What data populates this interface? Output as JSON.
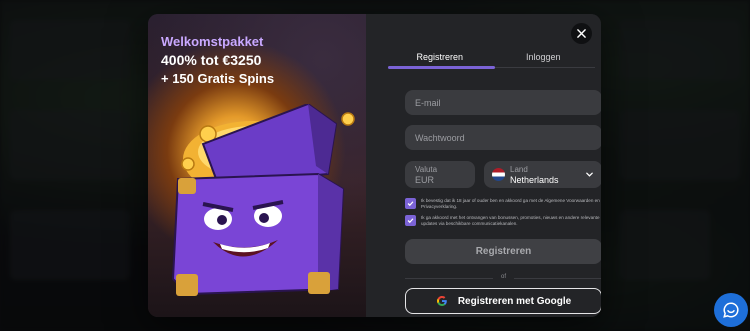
{
  "promo": {
    "line1": "Welkomstpakket",
    "line2": "400% tot €3250",
    "line3": "+ 150 Gratis Spins"
  },
  "tabs": [
    {
      "label": "Registreren",
      "active": true
    },
    {
      "label": "Inloggen",
      "active": false
    }
  ],
  "form": {
    "email_placeholder": "E-mail",
    "password_placeholder": "Wachtwoord",
    "currency_label": "Valuta",
    "currency_value": "EUR",
    "country_label": "Land",
    "country_value": "Netherlands",
    "consent_1": "Ik bevestig dat ik 18 jaar of ouder ben en akkoord ga met de Algemene Voorwaarden en Privacyverklaring.",
    "consent_2": "Ik ga akkoord met het ontvangen van bonussen, promoties, nieuws en andere relevante updates via beschikbare communicatiekanalen.",
    "register_label": "Registreren",
    "or_label": "of",
    "google_label": "Registreren met Google"
  },
  "colors": {
    "accent": "#7b63d6",
    "chat": "#1e6fd9"
  },
  "icons": [
    "close-icon",
    "chevron-down-icon",
    "check-icon",
    "google-icon",
    "chat-icon",
    "netherlands-flag-icon"
  ]
}
